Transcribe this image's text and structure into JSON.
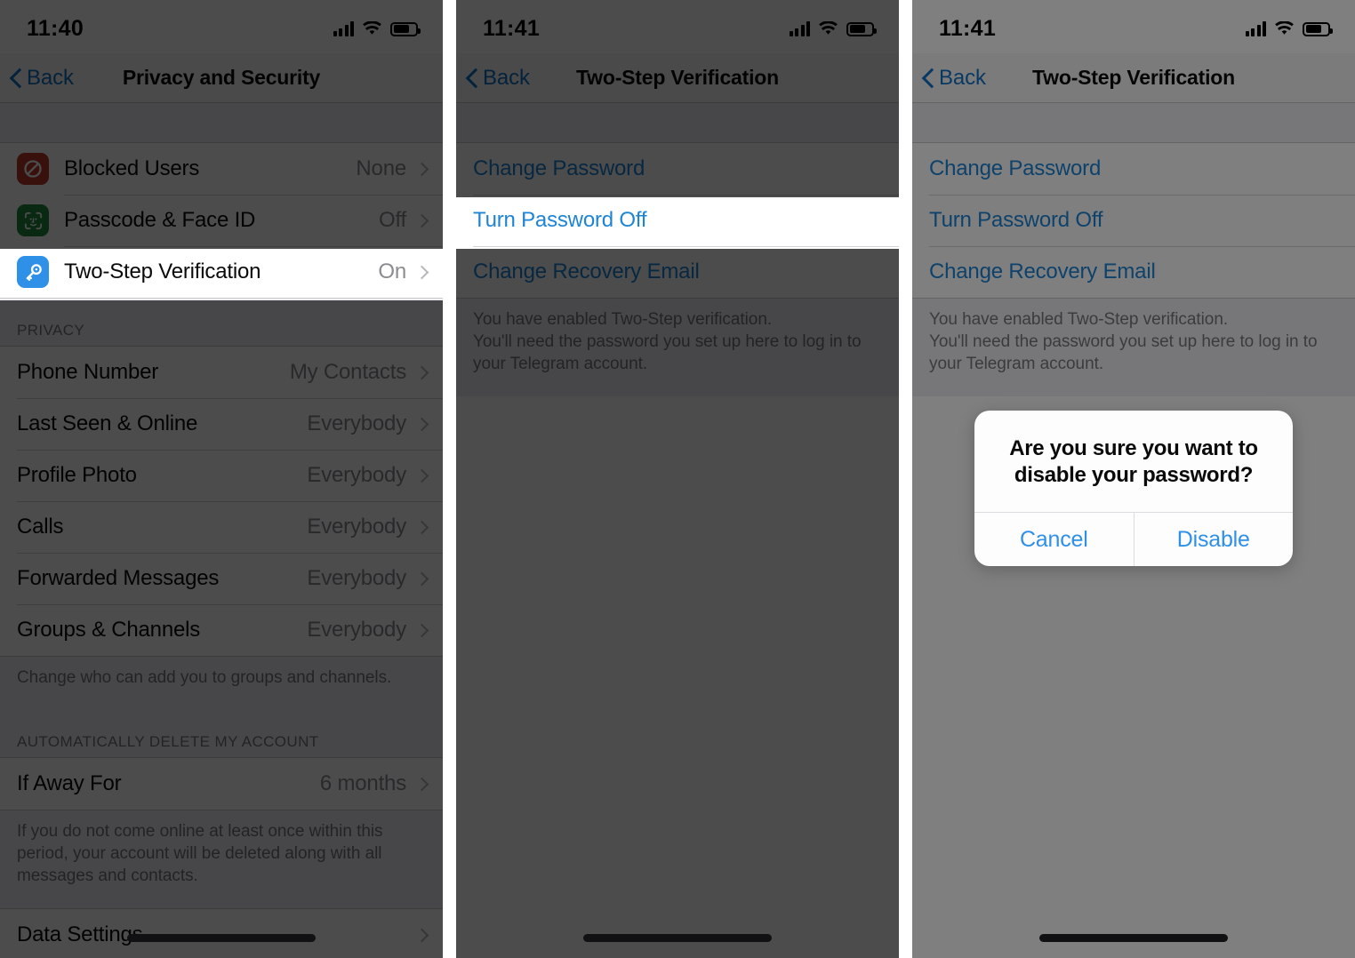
{
  "panels": [
    {
      "id": "privacy-and-security",
      "status": {
        "time": "11:40",
        "signal_icon": "cellular-signal-icon",
        "wifi_icon": "wifi-icon",
        "battery_icon": "battery-icon"
      },
      "nav": {
        "back_label": "Back",
        "title": "Privacy and Security",
        "back_icon": "chevron-left-icon"
      },
      "security_rows": [
        {
          "icon": "blocked-users-icon",
          "icon_color": "#c0392b",
          "label": "Blocked Users",
          "value": "None",
          "chevron": "chevron-right-icon"
        },
        {
          "icon": "face-id-icon",
          "icon_color": "#1f8b3e",
          "label": "Passcode & Face ID",
          "value": "Off",
          "chevron": "chevron-right-icon"
        },
        {
          "icon": "key-icon",
          "icon_color": "#2f90e8",
          "label": "Two-Step Verification",
          "value": "On",
          "chevron": "chevron-right-icon",
          "highlighted": true
        }
      ],
      "privacy_header": "PRIVACY",
      "privacy_rows": [
        {
          "label": "Phone Number",
          "value": "My Contacts"
        },
        {
          "label": "Last Seen & Online",
          "value": "Everybody"
        },
        {
          "label": "Profile Photo",
          "value": "Everybody"
        },
        {
          "label": "Calls",
          "value": "Everybody"
        },
        {
          "label": "Forwarded Messages",
          "value": "Everybody"
        },
        {
          "label": "Groups & Channels",
          "value": "Everybody"
        }
      ],
      "privacy_footer": "Change who can add you to groups and channels.",
      "delete_header": "AUTOMATICALLY DELETE MY ACCOUNT",
      "delete_rows": [
        {
          "label": "If Away For",
          "value": "6 months"
        }
      ],
      "delete_footer": "If you do not come online at least once within this period, your account will be deleted along with all messages and contacts.",
      "last_rows": [
        {
          "label": "Data Settings",
          "value": ""
        }
      ]
    },
    {
      "id": "two-step-verification-list",
      "status": {
        "time": "11:41",
        "signal_icon": "cellular-signal-icon",
        "wifi_icon": "wifi-icon",
        "battery_icon": "battery-icon"
      },
      "nav": {
        "back_label": "Back",
        "title": "Two-Step Verification",
        "back_icon": "chevron-left-icon"
      },
      "links": [
        {
          "label": "Change Password",
          "highlighted": false
        },
        {
          "label": "Turn Password Off",
          "highlighted": true
        },
        {
          "label": "Change Recovery Email",
          "highlighted": false
        }
      ],
      "footer": "You have enabled Two-Step verification.\nYou'll need the password you set up here to log in to your Telegram account."
    },
    {
      "id": "two-step-verification-alert",
      "status": {
        "time": "11:41",
        "signal_icon": "cellular-signal-icon",
        "wifi_icon": "wifi-icon",
        "battery_icon": "battery-icon"
      },
      "nav": {
        "back_label": "Back",
        "title": "Two-Step Verification",
        "back_icon": "chevron-left-icon"
      },
      "links": [
        {
          "label": "Change Password",
          "highlighted": false
        },
        {
          "label": "Turn Password Off",
          "highlighted": false
        },
        {
          "label": "Change Recovery Email",
          "highlighted": false
        }
      ],
      "footer": "You have enabled Two-Step verification.\nYou'll need the password you set up here to log in to your Telegram account.",
      "alert": {
        "title": "Are you sure you want to disable your password?",
        "cancel_label": "Cancel",
        "confirm_label": "Disable"
      }
    }
  ],
  "colors": {
    "link_blue": "#1d84d6",
    "tint_blue": "#2f90e8",
    "back_blue": "#1273c7",
    "list_bg": "#efeff4",
    "value_gray": "#8b8b90",
    "icon_red": "#c0392b",
    "icon_green": "#1f8b3e"
  }
}
